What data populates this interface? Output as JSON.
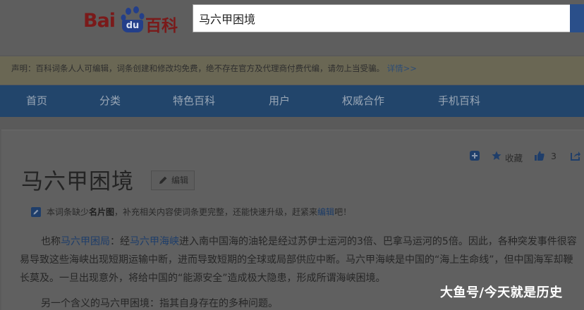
{
  "header": {
    "logo_bai": "Bai",
    "logo_du": "du",
    "logo_baike": "百科",
    "search_value": "马六甲困境"
  },
  "notice": {
    "text": "声明：百科词条人人可编辑，词条创建和修改均免费，绝不存在官方及代理商付费代编，请勿上当受骗。",
    "link": "详情>>"
  },
  "nav": {
    "items": [
      "首页",
      "分类",
      "特色百科",
      "用户",
      "权威合作",
      "手机百科"
    ]
  },
  "actions": {
    "collect_label": "收藏",
    "like_count": "3"
  },
  "article": {
    "title": "马六甲困境",
    "edit_label": "编辑",
    "tip": {
      "pre": "本词条缺少",
      "bold": "名片图",
      "mid": "，补充相关内容使词条更完整，还能快速升级，赶紧来",
      "link": "编辑",
      "post": "吧！"
    },
    "para1": {
      "a": "也称",
      "link1": "马六甲困局",
      "b": "：经",
      "link2": "马六甲海峡",
      "c": "进入南中国海的油轮是经过苏伊士运河的3倍、巴拿马运河的5倍。因此，各种突发事件很容易导致这些海峡出现短期运输中断，进而导致短期的全球或局部供应中断。马六甲海峡是中国的“海上生命线”，但中国海军却鞭长莫及。一旦出现意外，将给中国的“能源安全”造成极大隐患，形成所谓海峡困境。"
    },
    "para2": "另一个含义的马六甲困境：指其自身存在的多种问题。"
  },
  "watermark": "大鱼号/今天就是历史"
}
